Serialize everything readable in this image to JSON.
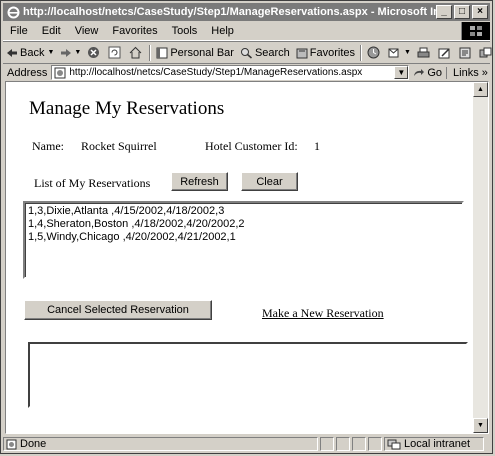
{
  "window": {
    "title": "http://localhost/netcs/CaseStudy/Step1/ManageReservations.aspx - Microsoft Internet Explo..."
  },
  "menu": [
    "File",
    "Edit",
    "View",
    "Favorites",
    "Tools",
    "Help"
  ],
  "toolbar": {
    "back_label": "Back",
    "personal_bar_label": "Personal Bar",
    "search_label": "Search",
    "favorites_label": "Favorites"
  },
  "address": {
    "label": "Address",
    "url": "http://localhost/netcs/CaseStudy/Step1/ManageReservations.aspx",
    "go_label": "Go",
    "links_label": "Links"
  },
  "page": {
    "heading": "Manage My Reservations",
    "name_label": "Name:",
    "name_value": "Rocket Squirrel",
    "customer_id_label": "Hotel Customer Id:",
    "customer_id_value": "1",
    "list_label": "List of My Reservations",
    "refresh_label": "Refresh",
    "clear_label": "Clear",
    "reservations": [
      "1,3,Dixie,Atlanta  ,4/15/2002,4/18/2002,3",
      "1,4,Sheraton,Boston  ,4/18/2002,4/20/2002,2",
      "1,5,Windy,Chicago  ,4/20/2002,4/21/2002,1"
    ],
    "cancel_label": "Cancel Selected Reservation",
    "new_reservation_link": "Make a New Reservation"
  },
  "status": {
    "text": "Done",
    "zone": "Local intranet"
  }
}
